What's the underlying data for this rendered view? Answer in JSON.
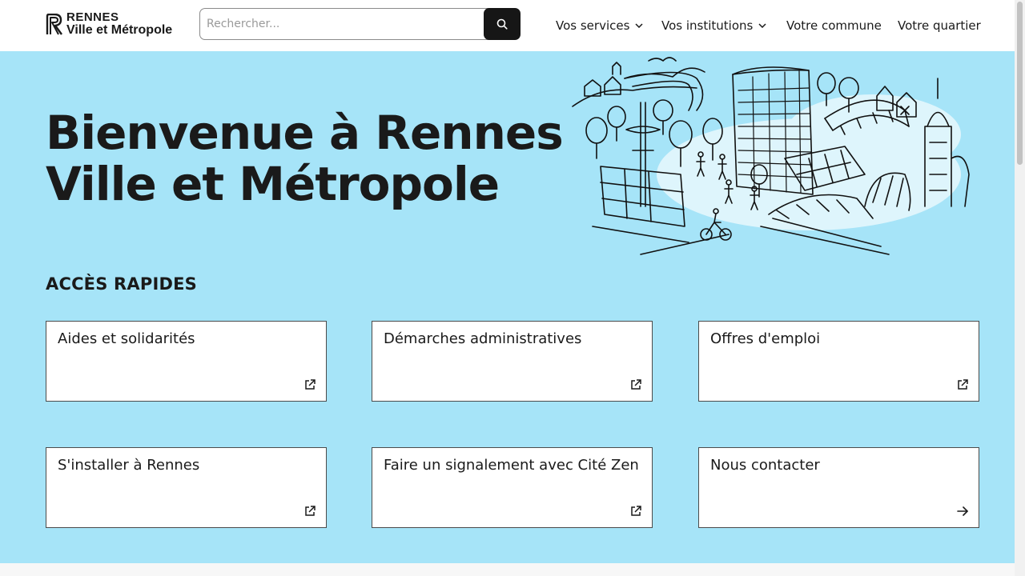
{
  "header": {
    "logo": {
      "line1": "RENNES",
      "line2": "Ville et Métropole"
    },
    "search": {
      "placeholder": "Rechercher...",
      "value": "",
      "button_icon": "search-icon"
    },
    "nav": [
      {
        "label": "Vos services",
        "has_dropdown": true
      },
      {
        "label": "Vos institutions",
        "has_dropdown": true
      },
      {
        "label": "Votre commune",
        "has_dropdown": false
      },
      {
        "label": "Votre quartier",
        "has_dropdown": false
      }
    ]
  },
  "hero": {
    "title_line1": "Bienvenue à Rennes",
    "title_line2": "Ville et Métropole"
  },
  "quick_access": {
    "title": "ACCÈS RAPIDES",
    "cards": [
      {
        "label": "Aides et solidarités",
        "icon": "external-link-icon"
      },
      {
        "label": "Démarches administratives",
        "icon": "external-link-icon"
      },
      {
        "label": "Offres d'emploi",
        "icon": "external-link-icon"
      },
      {
        "label": "S'installer à Rennes",
        "icon": "external-link-icon"
      },
      {
        "label": "Faire un signalement avec Cité Zen",
        "icon": "external-link-icon"
      },
      {
        "label": "Nous contacter",
        "icon": "arrow-right-icon"
      }
    ]
  },
  "colors": {
    "hero_background": "#a6e4f8",
    "header_background": "#ffffff",
    "search_button": "#161616",
    "text": "#1a1a1a",
    "card_border": "#4b4b4b"
  }
}
